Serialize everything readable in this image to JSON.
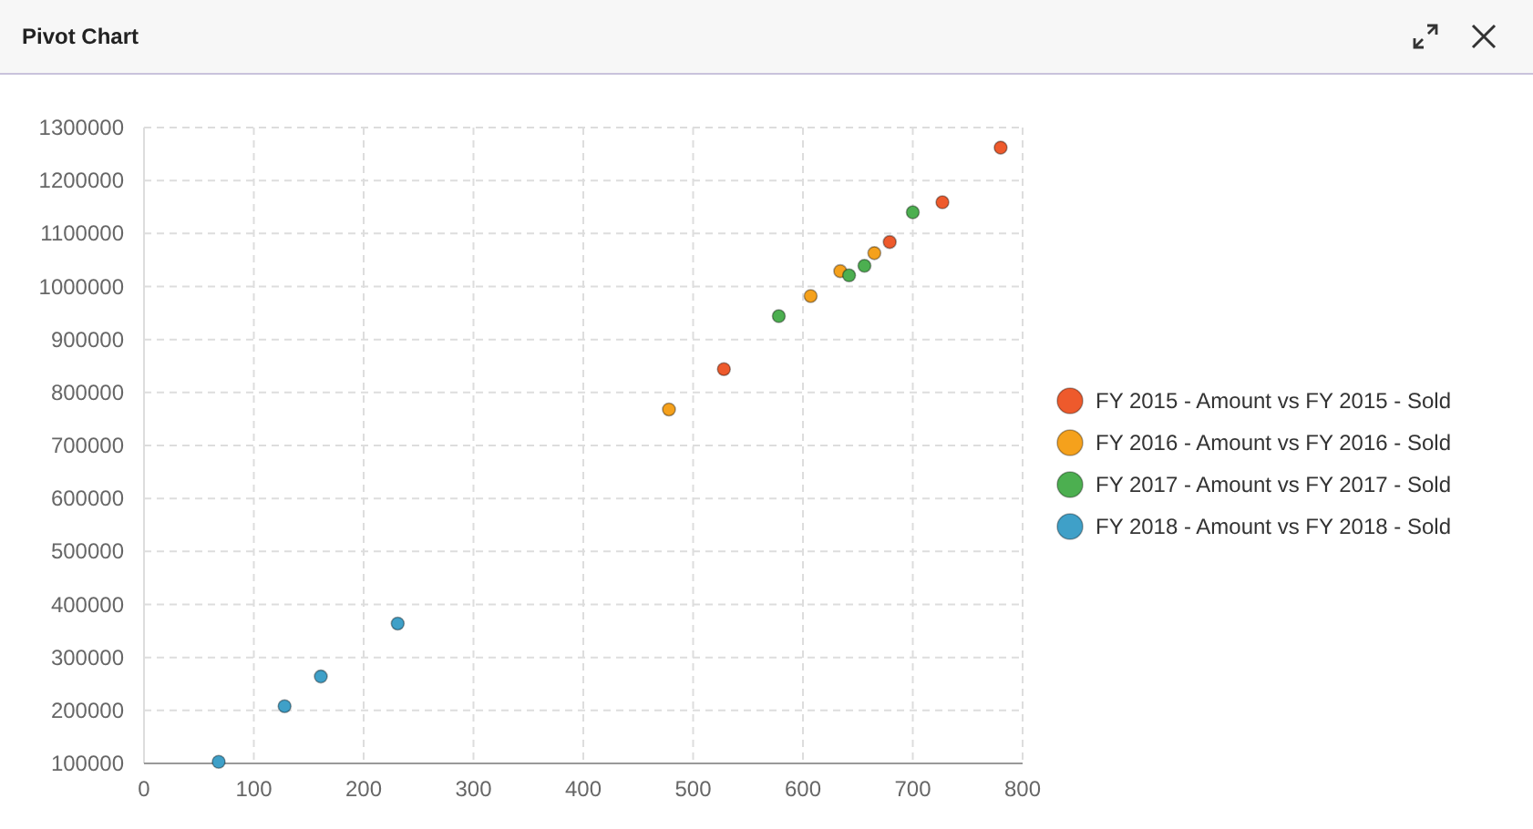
{
  "window": {
    "title": "Pivot Chart"
  },
  "chart_data": {
    "type": "scatter",
    "grid": true,
    "legend": "right",
    "xlim": [
      0,
      800
    ],
    "ylim": [
      100000,
      1300000
    ],
    "xticks": [
      0,
      100,
      200,
      300,
      400,
      500,
      600,
      700,
      800
    ],
    "yticks": [
      100000,
      200000,
      300000,
      400000,
      500000,
      600000,
      700000,
      800000,
      900000,
      1000000,
      1100000,
      1200000,
      1300000
    ],
    "series": [
      {
        "name": "FY 2015 - Amount vs FY 2015 - Sold",
        "color": "#ee5a2c",
        "x": [
          780,
          727,
          679,
          528
        ],
        "values": [
          1262000,
          1159000,
          1084000,
          844000
        ]
      },
      {
        "name": "FY 2016 - Amount vs FY 2016 - Sold",
        "color": "#f5a11c",
        "x": [
          665,
          634,
          607,
          478
        ],
        "values": [
          1063000,
          1029000,
          982000,
          768000
        ]
      },
      {
        "name": "FY 2017 - Amount vs FY 2017 - Sold",
        "color": "#4caf50",
        "x": [
          700,
          656,
          642,
          578
        ],
        "values": [
          1140000,
          1039000,
          1021000,
          944000
        ]
      },
      {
        "name": "FY 2018 - Amount vs FY 2018 - Sold",
        "color": "#3fa0c8",
        "x": [
          231,
          161,
          128,
          68
        ],
        "values": [
          364000,
          264000,
          208000,
          103000
        ]
      }
    ]
  }
}
